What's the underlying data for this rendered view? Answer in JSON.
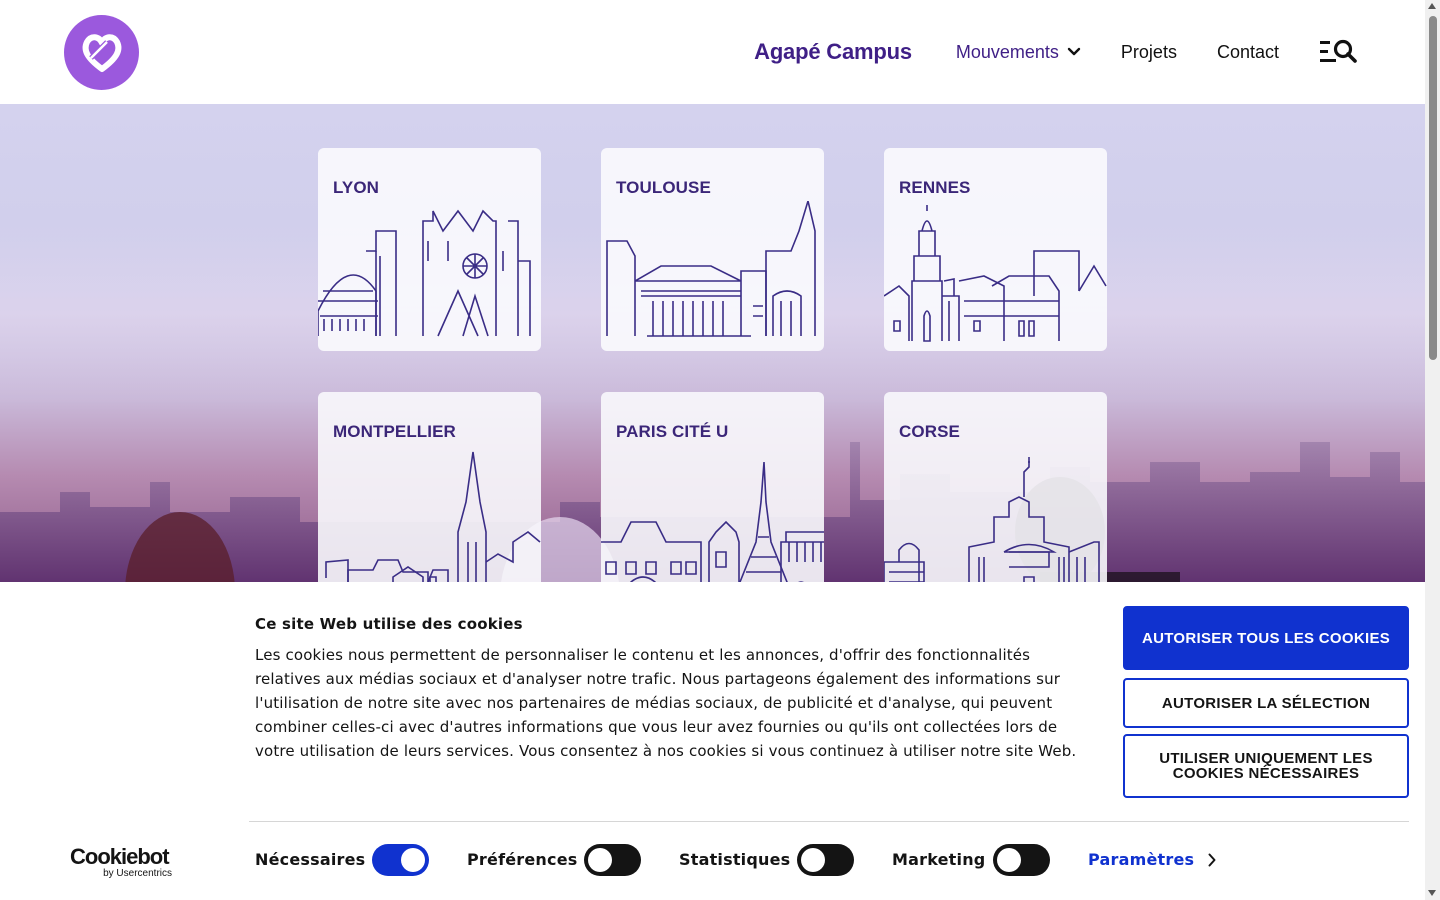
{
  "header": {
    "brand": "Agapé Campus",
    "nav": [
      {
        "label": "Mouvements",
        "active": true,
        "has_dropdown": true
      },
      {
        "label": "Projets",
        "active": false
      },
      {
        "label": "Contact",
        "active": false
      }
    ],
    "logo_icon": "heart-knot-logo",
    "menu_icon": "menu-search-icon",
    "accent_color": "#3f1f86",
    "logo_color": "#9b59dd"
  },
  "hero": {
    "cards": [
      {
        "city": "LYON"
      },
      {
        "city": "TOULOUSE"
      },
      {
        "city": "RENNES"
      },
      {
        "city": "MONTPELLIER"
      },
      {
        "city": "PARIS CITÉ U"
      },
      {
        "city": "CORSE"
      }
    ]
  },
  "cookie": {
    "title": "Ce site Web utilise des cookies",
    "text": "Les cookies nous permettent de personnaliser le contenu et les annonces, d'offrir des fonctionnalités relatives aux médias sociaux et d'analyser notre trafic. Nous partageons également des informations sur l'utilisation de notre site avec nos partenaires de médias sociaux, de publicité et d'analyse, qui peuvent combiner celles-ci avec d'autres informations que vous leur avez fournies ou qu'ils ont collectées lors de votre utilisation de leurs services. Vous consentez à nos cookies si vous continuez à utiliser notre site Web.",
    "buttons": {
      "allow_all": "AUTORISER TOUS LES COOKIES",
      "allow_selection": "AUTORISER LA SÉLECTION",
      "necessary_only": "UTILISER UNIQUEMENT LES COOKIES NÉCESSAIRES"
    },
    "toggles": [
      {
        "label": "Nécessaires",
        "on": true
      },
      {
        "label": "Préférences",
        "on": false
      },
      {
        "label": "Statistiques",
        "on": false
      },
      {
        "label": "Marketing",
        "on": false
      }
    ],
    "settings_label": "Paramètres",
    "provider": {
      "name": "Cookiebot",
      "sub": "by Usercentrics"
    },
    "button_color": "#1032cf"
  }
}
